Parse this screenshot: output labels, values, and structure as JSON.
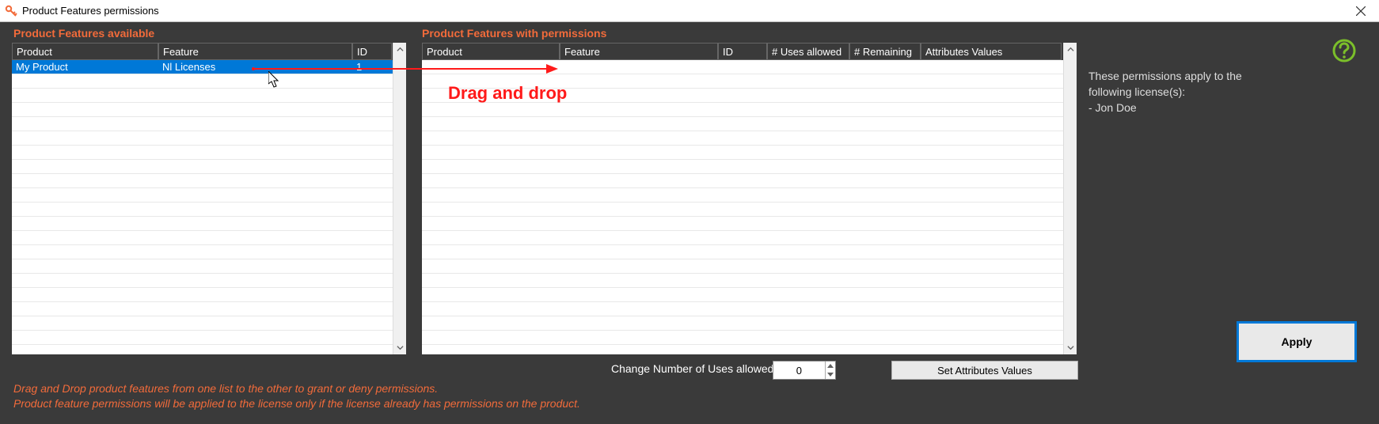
{
  "window": {
    "title": "Product Features permissions"
  },
  "available": {
    "heading": "Product Features available",
    "columns": {
      "product": "Product",
      "feature": "Feature",
      "id": "ID"
    },
    "rows": [
      {
        "product": "My Product",
        "feature": "Nl Licenses",
        "id": "1"
      }
    ]
  },
  "withPermissions": {
    "heading": "Product Features with permissions",
    "columns": {
      "product": "Product",
      "feature": "Feature",
      "id": "ID",
      "usesAllowed": "# Uses allowed",
      "remaining": "# Remaining",
      "attributes": "Attributes Values"
    },
    "rows": []
  },
  "info": {
    "line1": "These permissions apply to the following license(s):",
    "line2": "- Jon Doe"
  },
  "controls": {
    "usesLabel": "Change Number of Uses allowed",
    "usesValue": "0",
    "setAttributes": "Set Attributes Values",
    "apply": "Apply"
  },
  "hints": {
    "line1": "Drag and Drop product features from one list to the other to grant or deny permissions.",
    "line2": "Product feature permissions will be applied to the license only if the license already has permissions on the product."
  },
  "annotation": {
    "dragLabel": "Drag and drop"
  }
}
